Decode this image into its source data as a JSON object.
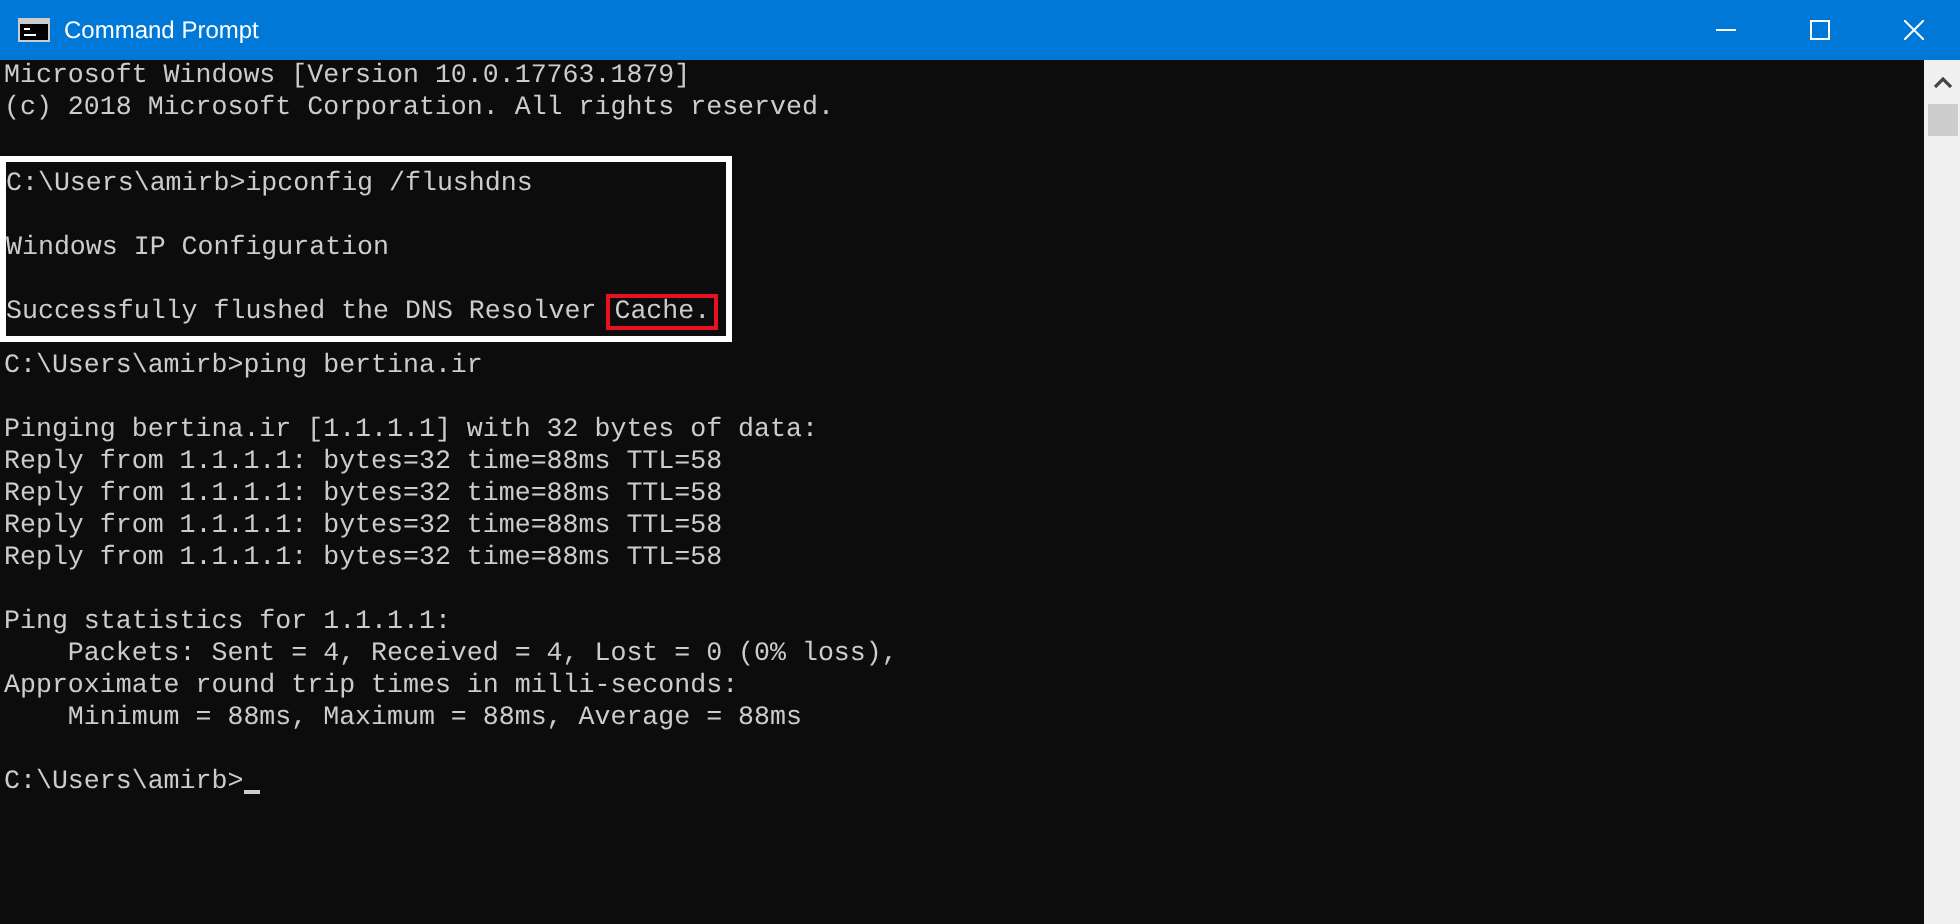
{
  "window": {
    "title": "Command Prompt"
  },
  "console": {
    "sections": [
      {
        "framed": false,
        "paragraphs": [
          [
            {
              "text": "Microsoft Windows [Version 10.0.17763.1879]"
            },
            {
              "text": "(c) 2018 Microsoft Corporation. All rights reserved."
            }
          ]
        ]
      },
      {
        "framed": true,
        "paragraphs": [
          [
            {
              "text": "C:\\Users\\amirb>ipconfig /flushdns"
            }
          ],
          [
            {
              "text": "Windows IP Configuration"
            }
          ],
          [
            {
              "text": "Successfully flushed the DNS Resolver ",
              "boxed": "Cache."
            }
          ]
        ]
      },
      {
        "framed": false,
        "paragraphs": [
          [
            {
              "text": "C:\\Users\\amirb>ping bertina.ir"
            }
          ],
          [
            {
              "text": "Pinging bertina.ir [1.1.1.1] with 32 bytes of data:"
            },
            {
              "text": "Reply from 1.1.1.1: bytes=32 time=88ms TTL=58"
            },
            {
              "text": "Reply from 1.1.1.1: bytes=32 time=88ms TTL=58"
            },
            {
              "text": "Reply from 1.1.1.1: bytes=32 time=88ms TTL=58"
            },
            {
              "text": "Reply from 1.1.1.1: bytes=32 time=88ms TTL=58"
            }
          ],
          [
            {
              "text": "Ping statistics for 1.1.1.1:"
            },
            {
              "text": "    Packets: Sent = 4, Received = 4, Lost = 0 (0% loss),"
            },
            {
              "text": "Approximate round trip times in milli-seconds:"
            },
            {
              "text": "    Minimum = 88ms, Maximum = 88ms, Average = 88ms"
            }
          ],
          [
            {
              "text": "C:\\Users\\amirb>",
              "cursor": true
            }
          ]
        ]
      }
    ]
  }
}
